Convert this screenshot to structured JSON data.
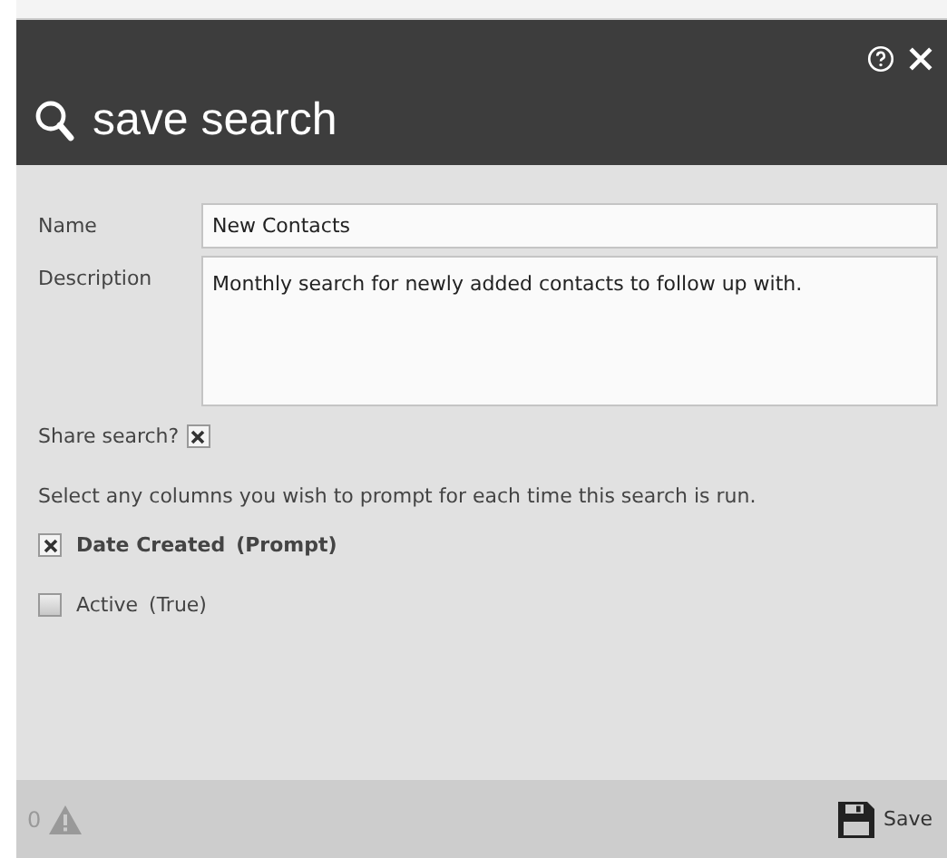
{
  "dialog": {
    "title": "save search"
  },
  "form": {
    "name": {
      "label": "Name",
      "value": "New Contacts"
    },
    "description": {
      "label": "Description",
      "value": "Monthly search for newly added contacts to follow up with."
    },
    "share": {
      "label": "Share search?",
      "checked": true
    }
  },
  "prompt_text": "Select any columns you wish to prompt for each time this search is run.",
  "columns": [
    {
      "name": "Date Created",
      "note": "(Prompt)",
      "checked": true
    },
    {
      "name": "Active",
      "note": "(True)",
      "checked": false
    }
  ],
  "footer": {
    "warning_count": "0",
    "save_label": "Save"
  }
}
